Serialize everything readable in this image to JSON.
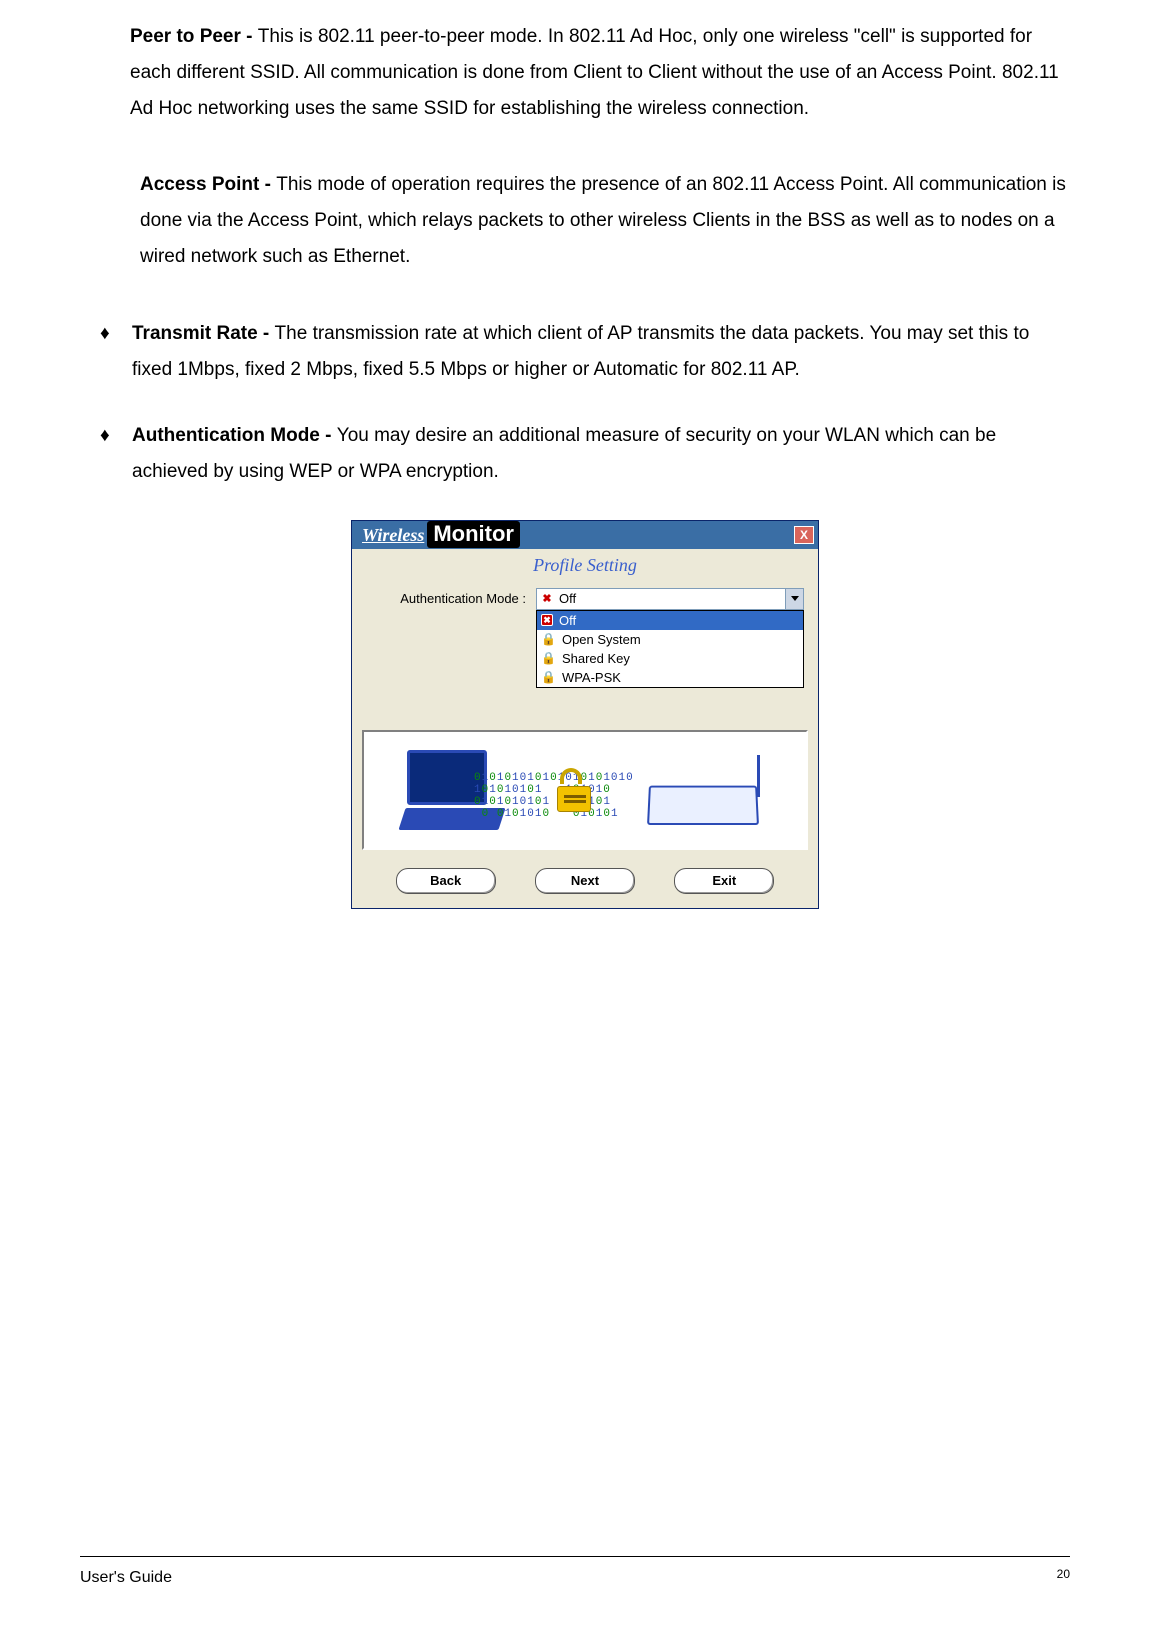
{
  "paragraphs": {
    "peer_label": "Peer to Peer   - ",
    "peer_text": "This is 802.11 peer-to-peer mode. In 802.11 Ad Hoc, only one wireless \"cell\" is supported for each different SSID. All communication is done from Client to Client without the use of an Access Point. 802.11 Ad Hoc networking uses the same SSID for establishing the wireless connection.",
    "ap_label": "Access Point  - ",
    "ap_text": "This mode of operation requires the presence of an 802.11 Access Point. All communication is done via the Access Point, which relays packets to other wireless Clients in the BSS as well as to nodes on a wired network such as Ethernet.",
    "rate_label": "Transmit Rate - ",
    "rate_text": "The transmission rate at which client of AP transmits the data packets. You may set this to fixed 1Mbps, fixed 2 Mbps, fixed 5.5 Mbps or higher or Automatic for 802.11 AP.",
    "auth_label": "Authentication Mode - ",
    "auth_text": "You may desire an additional measure of security on your WLAN which can be achieved by using WEP or WPA encryption."
  },
  "dialog": {
    "title_left": "Wireless",
    "title_right": "Monitor",
    "close": "X",
    "subtitle": "Profile Setting",
    "field_label": "Authentication Mode :",
    "selected": "Off",
    "options": [
      "Off",
      "Open System",
      "Shared Key",
      "WPA-PSK"
    ],
    "buttons": {
      "back": "Back",
      "next": "Next",
      "exit": "Exit"
    }
  },
  "footer": {
    "guide": "User's Guide",
    "page": "20"
  }
}
